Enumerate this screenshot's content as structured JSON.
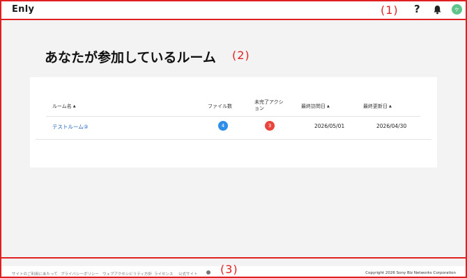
{
  "header": {
    "logo": "Enly",
    "help_icon": "?",
    "avatar_initial": "ケ"
  },
  "page": {
    "title": "あなたが参加しているルーム"
  },
  "table": {
    "columns": {
      "room_name": "ルーム名",
      "file_count": "ファイル数",
      "pending_actions": "未完了アクション",
      "last_visited": "最終訪問日",
      "last_updated": "最終更新日"
    },
    "sort_icon": "▲",
    "rows": [
      {
        "room_name": "テストルーム③",
        "file_count": "4",
        "pending_actions": "3",
        "last_visited": "2026/05/01",
        "last_updated": "2026/04/30"
      }
    ]
  },
  "footer": {
    "links": [
      "サイトのご利用にあたって",
      "プライバシーポリシー",
      "ウェブアクセシビリティ方針",
      "ライセンス",
      "公式サイト"
    ],
    "copyright": "Copyright 2026 Sony Biz Networks Corporation"
  },
  "annotations": {
    "label1": "(1)",
    "label2": "(2)",
    "label3": "(3)"
  },
  "colors": {
    "badge_files": "#2f8fe8",
    "badge_actions": "#e8453c",
    "avatar": "#5fc48a",
    "annotation": "#e02020"
  }
}
